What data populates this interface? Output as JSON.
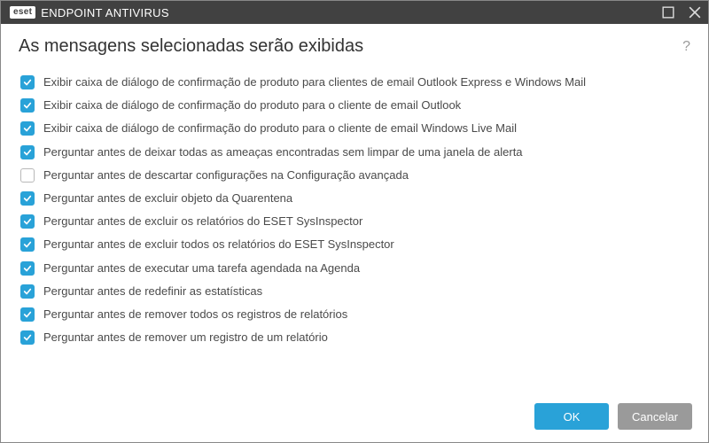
{
  "titlebar": {
    "brand": "eset",
    "app_name": "ENDPOINT ANTIVIRUS"
  },
  "header": {
    "heading": "As mensagens selecionadas serão exibidas",
    "help": "?"
  },
  "messages": [
    {
      "checked": true,
      "label": "Exibir caixa de diálogo de confirmação de produto para clientes de email Outlook Express e Windows Mail"
    },
    {
      "checked": true,
      "label": "Exibir caixa de diálogo de confirmação do produto para o cliente de email Outlook"
    },
    {
      "checked": true,
      "label": "Exibir caixa de diálogo de confirmação do produto para o cliente de email Windows Live Mail"
    },
    {
      "checked": true,
      "label": "Perguntar antes de deixar todas as ameaças encontradas sem limpar de uma janela de alerta"
    },
    {
      "checked": false,
      "label": "Perguntar antes de descartar configurações na Configuração avançada"
    },
    {
      "checked": true,
      "label": "Perguntar antes de excluir objeto da Quarentena"
    },
    {
      "checked": true,
      "label": "Perguntar antes de excluir os relatórios do ESET SysInspector"
    },
    {
      "checked": true,
      "label": "Perguntar antes de excluir todos os relatórios do ESET SysInspector"
    },
    {
      "checked": true,
      "label": "Perguntar antes de executar uma tarefa agendada na Agenda"
    },
    {
      "checked": true,
      "label": "Perguntar antes de redefinir as estatísticas"
    },
    {
      "checked": true,
      "label": "Perguntar antes de remover todos os registros de relatórios"
    },
    {
      "checked": true,
      "label": "Perguntar antes de remover um registro de um relatório"
    }
  ],
  "footer": {
    "ok": "OK",
    "cancel": "Cancelar"
  }
}
